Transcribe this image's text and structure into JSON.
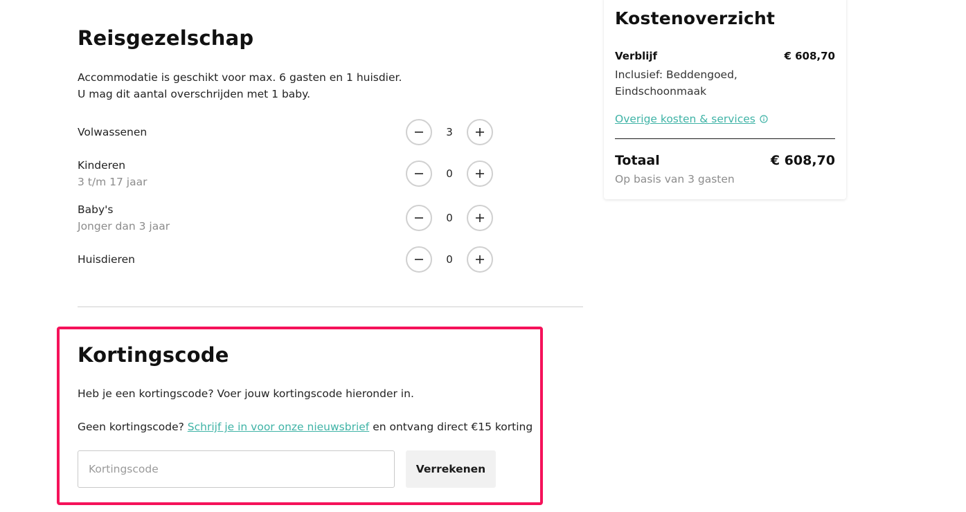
{
  "travel_party": {
    "title": "Reisgezelschap",
    "intro_line1": "Accommodatie is geschikt voor max. 6 gasten en 1 huisdier.",
    "intro_line2": "U mag dit aantal overschrijden met 1 baby.",
    "rows": [
      {
        "label": "Volwassenen",
        "sub": "",
        "value": "3"
      },
      {
        "label": "Kinderen",
        "sub": "3 t/m 17 jaar",
        "value": "0"
      },
      {
        "label": "Baby's",
        "sub": "Jonger dan 3 jaar",
        "value": "0"
      },
      {
        "label": "Huisdieren",
        "sub": "",
        "value": "0"
      }
    ],
    "icons": {
      "decrement": "minus-icon",
      "increment": "plus-icon"
    }
  },
  "discount": {
    "title": "Kortingscode",
    "text1": "Heb je een kortingscode? Voer jouw kortingscode hieronder in.",
    "text2_before": "Geen kortingscode?",
    "text2_link": "Schrijf je in voor onze nieuwsbrief",
    "text2_after": "en ontvang direct €15 korting",
    "input_placeholder": "Kortingscode",
    "input_value": "",
    "apply_label": "Verrekenen",
    "highlight_color": "#f5125a"
  },
  "cost_overview": {
    "title": "Kostenoverzicht",
    "stay_label": "Verblijf",
    "stay_price": "€ 608,70",
    "stay_included": "Inclusief: Beddengoed, Eindschoonmaak",
    "other_costs_link": "Overige kosten & services",
    "other_costs_icon": "info-icon",
    "total_label": "Totaal",
    "total_price": "€ 608,70",
    "total_sub": "Op basis van 3 gasten"
  },
  "colors": {
    "link": "#3fb3a6",
    "muted": "#8c8c8c",
    "stepper_border": "#d0d0d0",
    "button_bg": "#f1f1f1"
  }
}
